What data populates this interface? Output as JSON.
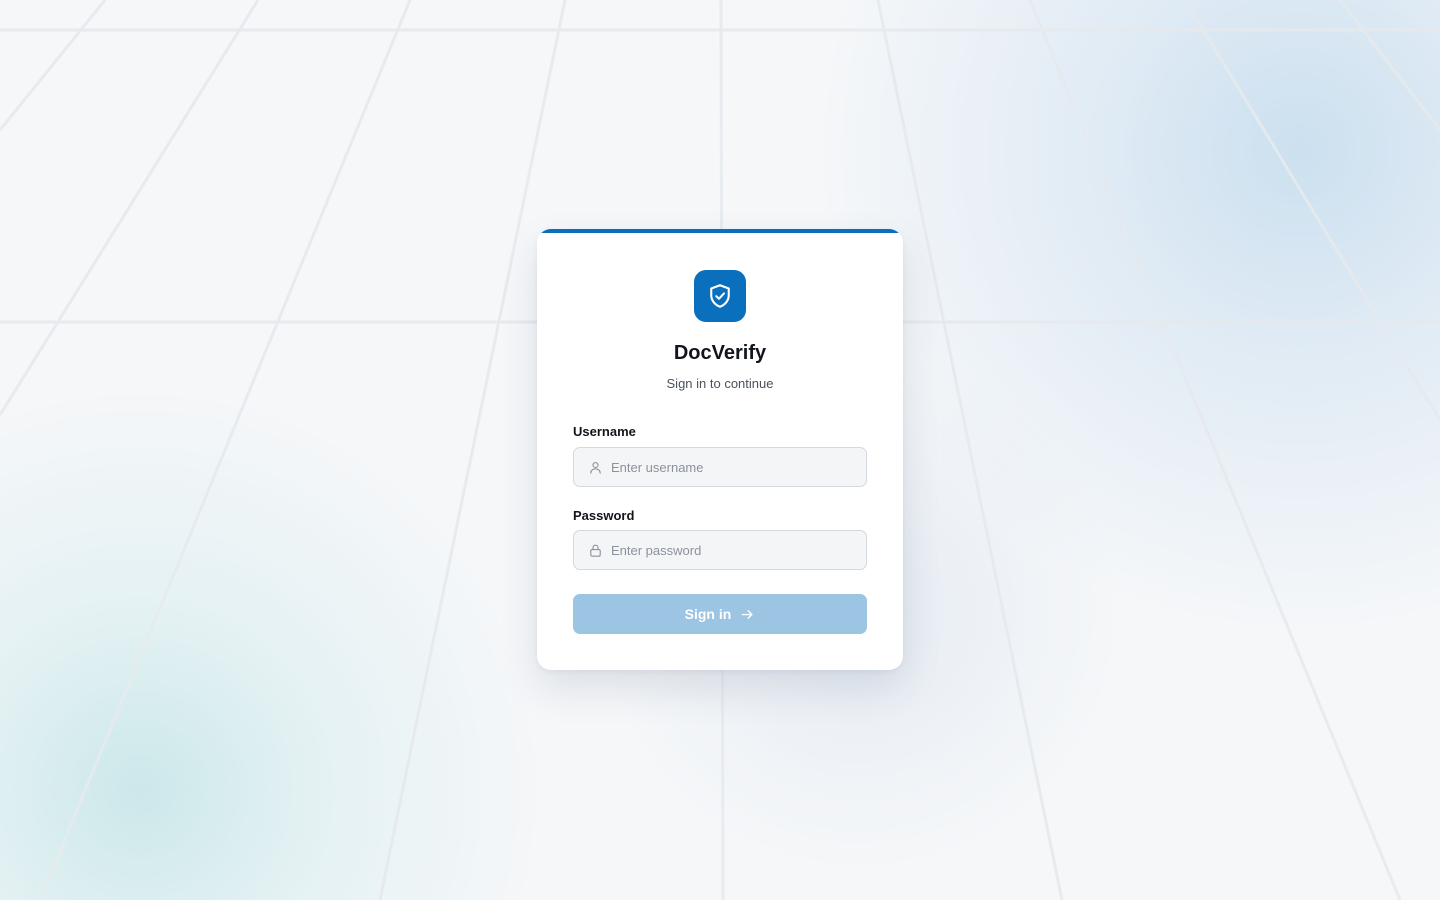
{
  "app": {
    "name": "DocVerify",
    "subtitle": "Sign in to continue",
    "brand_color": "#0a6fbd"
  },
  "form": {
    "username": {
      "label": "Username",
      "placeholder": "Enter username",
      "value": "",
      "icon": "user-icon"
    },
    "password": {
      "label": "Password",
      "placeholder": "Enter password",
      "value": "",
      "icon": "lock-icon"
    },
    "submit": {
      "label": "Sign in",
      "icon": "arrow-right-icon",
      "disabled": true,
      "color": "#9bc5e3"
    }
  },
  "logo": {
    "icon": "shield-check-icon"
  }
}
